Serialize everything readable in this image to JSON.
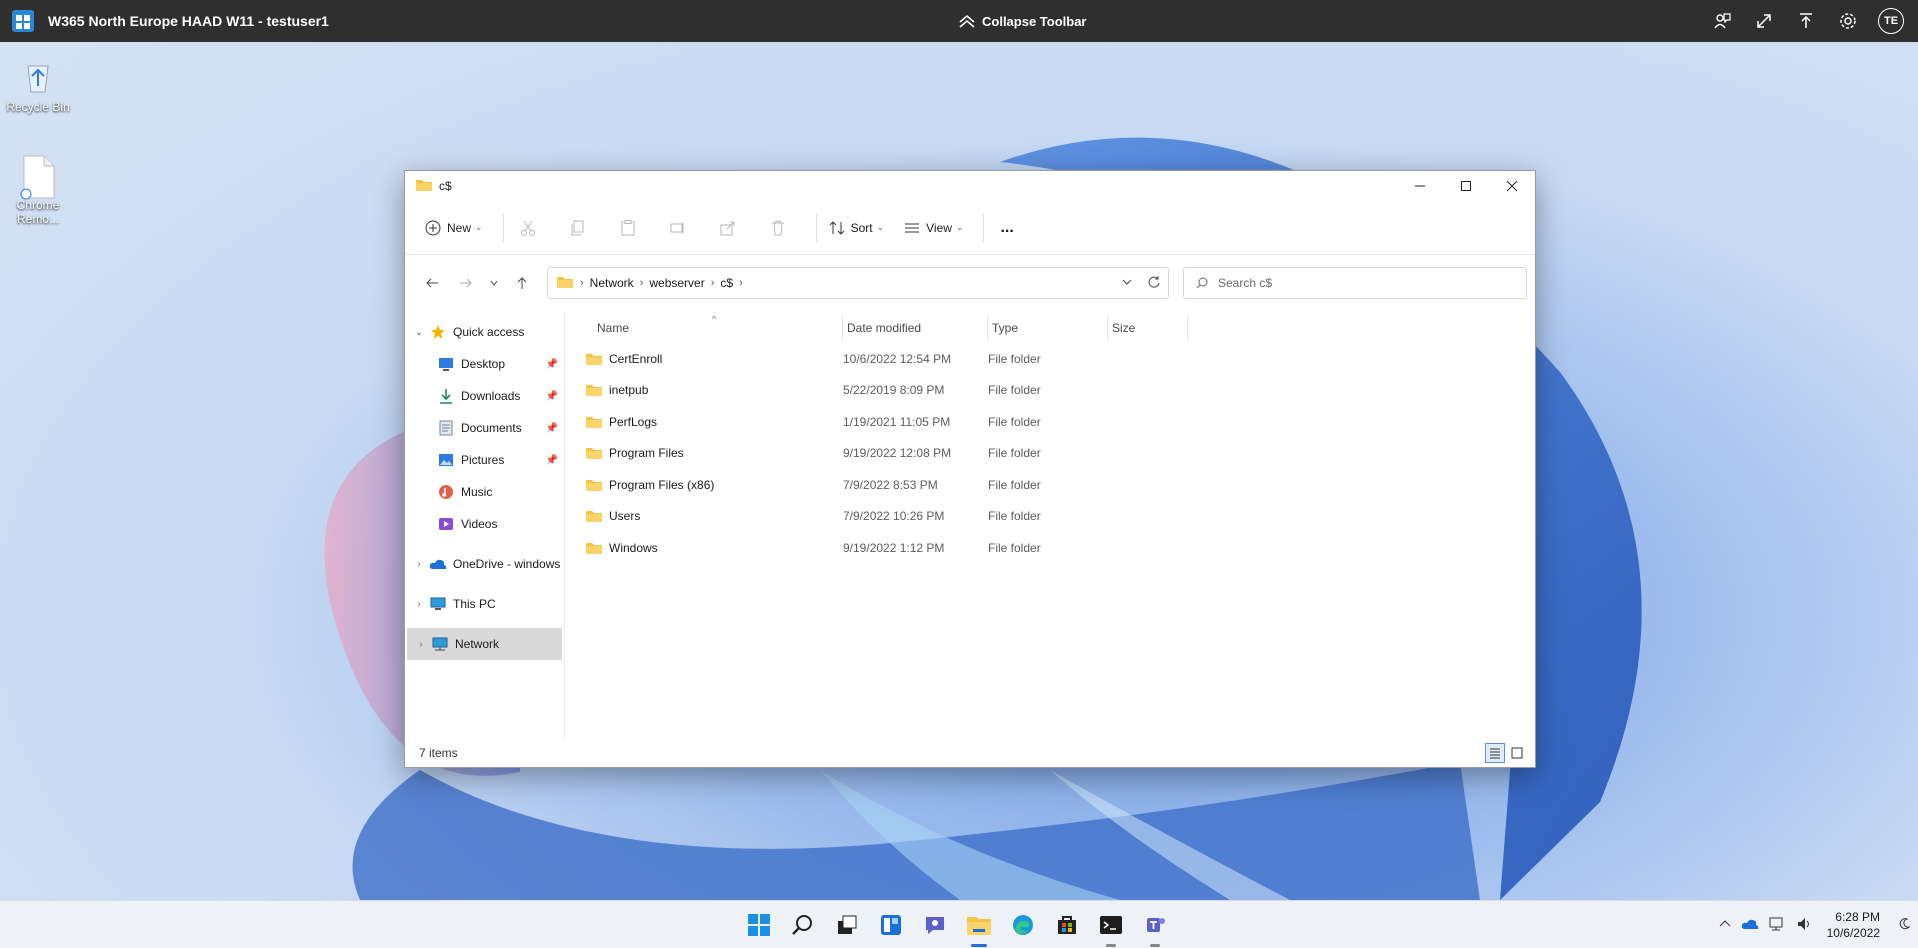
{
  "remote_bar": {
    "title": "W365 North Europe HAAD W11 - testuser1",
    "collapse_label": "Collapse Toolbar",
    "avatar_initials": "TE"
  },
  "desktop": {
    "icons": [
      {
        "label": "Recycle Bin",
        "icon": "recycle-bin-icon"
      },
      {
        "label": "Chrome Remo...",
        "icon": "file-icon"
      }
    ]
  },
  "window": {
    "title": "c$",
    "command_bar": {
      "new_label": "New",
      "sort_label": "Sort",
      "view_label": "View",
      "more_label": "..."
    },
    "address": {
      "crumbs": [
        "Network",
        "webserver",
        "c$"
      ]
    },
    "search": {
      "placeholder": "Search c$"
    },
    "nav": {
      "quick_access": "Quick access",
      "items": [
        {
          "label": "Desktop",
          "icon": "desktop-icon",
          "pinned": true
        },
        {
          "label": "Downloads",
          "icon": "download-icon",
          "pinned": true
        },
        {
          "label": "Documents",
          "icon": "documents-icon",
          "pinned": true
        },
        {
          "label": "Pictures",
          "icon": "pictures-icon",
          "pinned": true
        },
        {
          "label": "Music",
          "icon": "music-icon",
          "pinned": false
        },
        {
          "label": "Videos",
          "icon": "videos-icon",
          "pinned": false
        }
      ],
      "onedrive": "OneDrive - windows",
      "this_pc": "This PC",
      "network": "Network"
    },
    "columns": {
      "name": "Name",
      "date": "Date modified",
      "type": "Type",
      "size": "Size"
    },
    "files": [
      {
        "name": "CertEnroll",
        "date": "10/6/2022 12:54 PM",
        "type": "File folder"
      },
      {
        "name": "inetpub",
        "date": "5/22/2019 8:09 PM",
        "type": "File folder"
      },
      {
        "name": "PerfLogs",
        "date": "1/19/2021 11:05 PM",
        "type": "File folder"
      },
      {
        "name": "Program Files",
        "date": "9/19/2022 12:08 PM",
        "type": "File folder"
      },
      {
        "name": "Program Files (x86)",
        "date": "7/9/2022 8:53 PM",
        "type": "File folder"
      },
      {
        "name": "Users",
        "date": "7/9/2022 10:26 PM",
        "type": "File folder"
      },
      {
        "name": "Windows",
        "date": "9/19/2022 1:12 PM",
        "type": "File folder"
      }
    ],
    "status": "7 items"
  },
  "taskbar": {
    "time": "6:28 PM",
    "date": "10/6/2022",
    "apps": [
      "start-icon",
      "search-icon",
      "task-view-icon",
      "widgets-icon",
      "chat-icon",
      "file-explorer-icon",
      "edge-icon",
      "store-icon",
      "terminal-icon",
      "teams-icon"
    ]
  },
  "colors": {
    "accent": "#1a6fd8",
    "folder": "#f5c342",
    "remote_bar": "#2f2f2f"
  }
}
